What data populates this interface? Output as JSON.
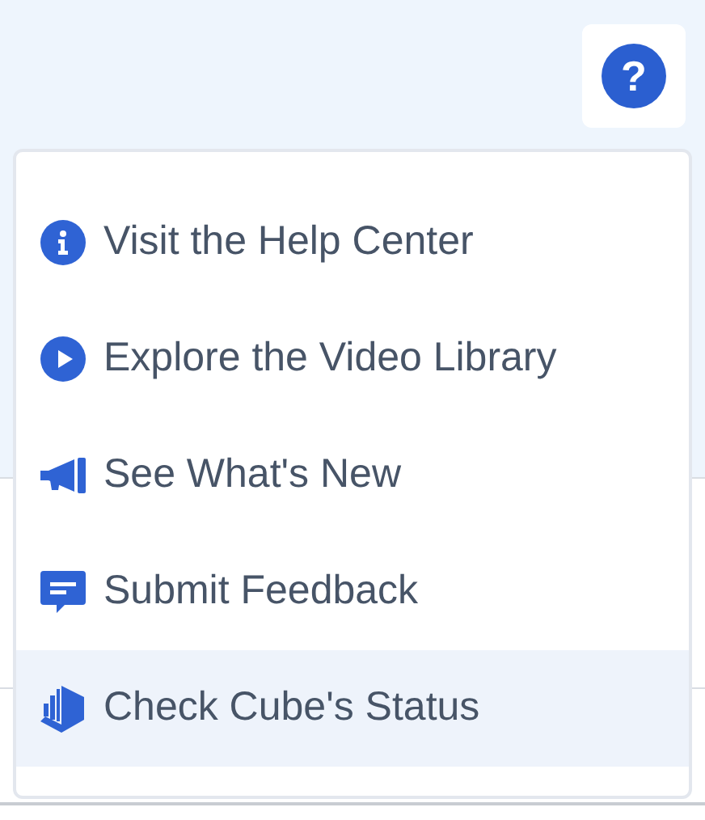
{
  "help_button": {
    "label": "?"
  },
  "menu": {
    "items": [
      {
        "kind": "info",
        "label": "Visit the Help Center",
        "selected": false
      },
      {
        "kind": "video",
        "label": "Explore the Video Library",
        "selected": false
      },
      {
        "kind": "megaphone",
        "label": "See What's New",
        "selected": false
      },
      {
        "kind": "feedback",
        "label": "Submit Feedback",
        "selected": false
      },
      {
        "kind": "cube",
        "label": "Check Cube's Status",
        "selected": true
      }
    ]
  }
}
